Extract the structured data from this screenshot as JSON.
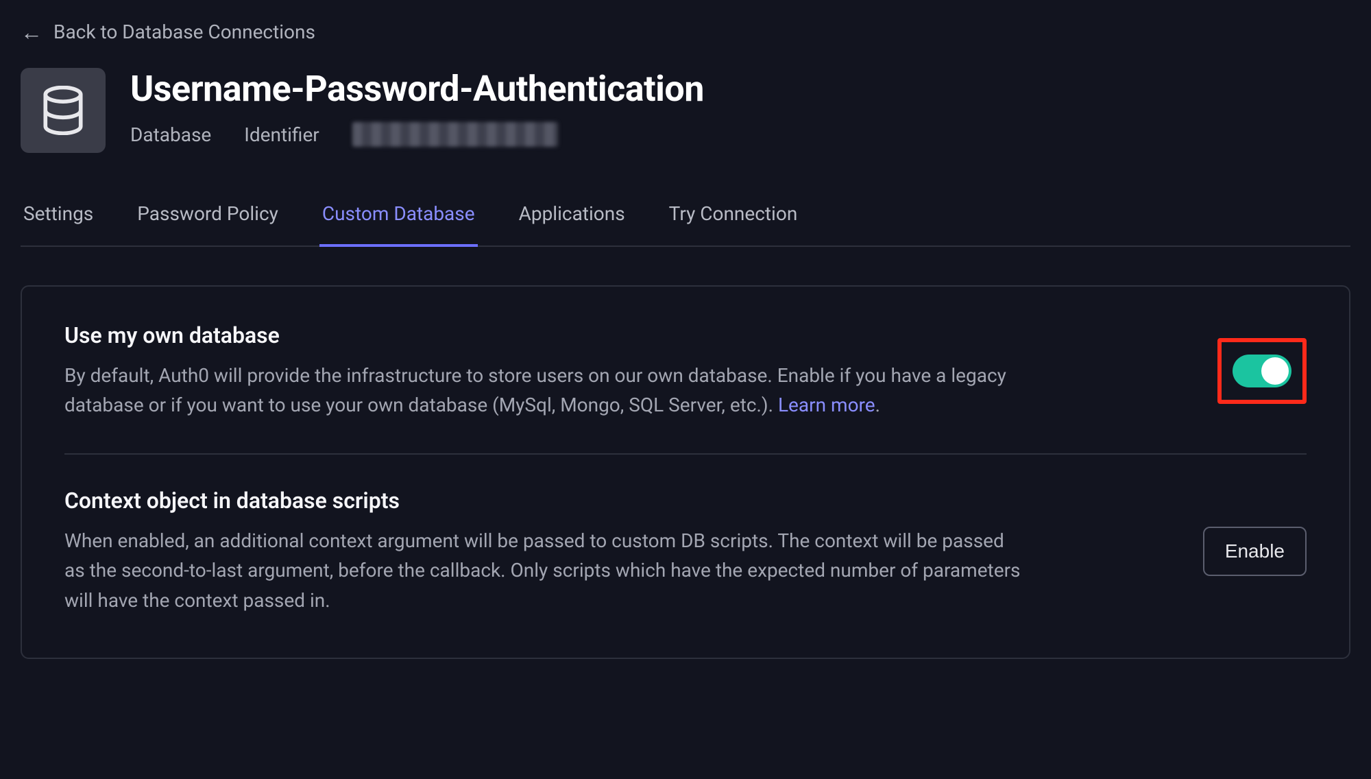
{
  "back_link": "Back to Database Connections",
  "header": {
    "title": "Username-Password-Authentication",
    "type_label": "Database",
    "identifier_label": "Identifier"
  },
  "tabs": [
    {
      "label": "Settings",
      "active": false
    },
    {
      "label": "Password Policy",
      "active": false
    },
    {
      "label": "Custom Database",
      "active": true
    },
    {
      "label": "Applications",
      "active": false
    },
    {
      "label": "Try Connection",
      "active": false
    }
  ],
  "settings": {
    "own_db": {
      "title": "Use my own database",
      "desc_pre": "By default, Auth0 will provide the infrastructure to store users on our own database. Enable if you have a legacy database or if you want to use your own database (MySql, Mongo, SQL Server, etc.). ",
      "learn_more": "Learn more",
      "desc_post": ".",
      "enabled": true
    },
    "context_obj": {
      "title": "Context object in database scripts",
      "desc": "When enabled, an additional context argument will be passed to custom DB scripts. The context will be passed as the second-to-last argument, before the callback. Only scripts which have the expected number of parameters will have the context passed in.",
      "button": "Enable"
    }
  }
}
